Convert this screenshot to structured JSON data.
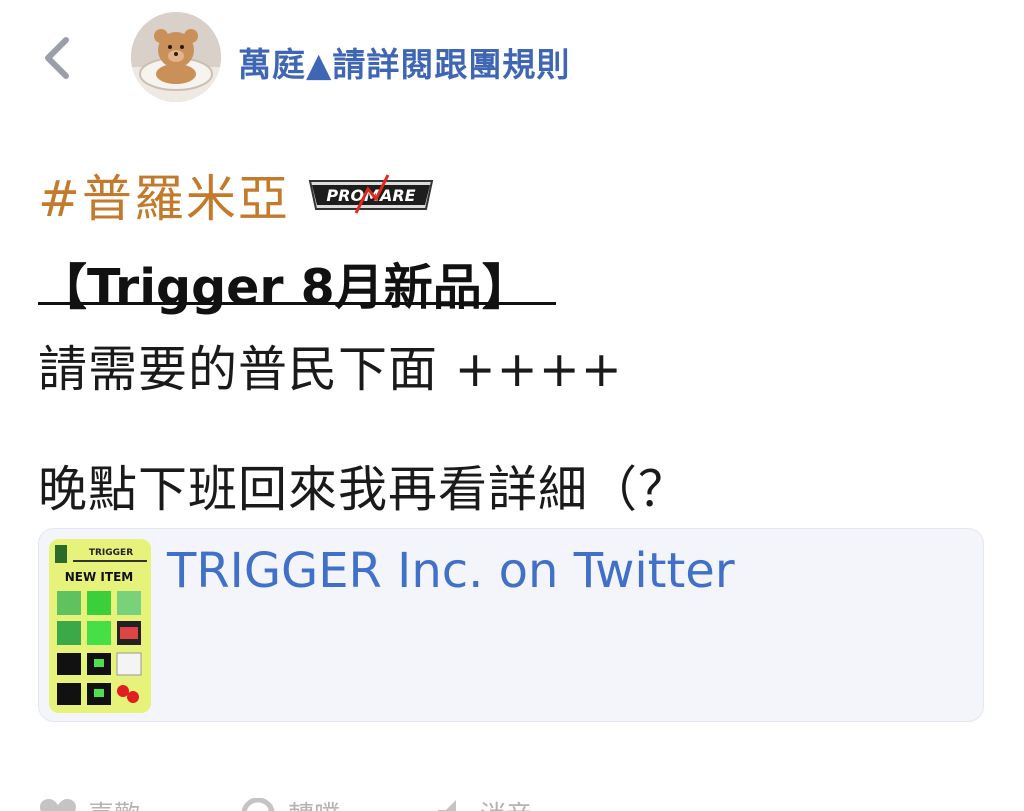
{
  "header": {
    "back_icon": "chevron-left-icon",
    "author_name": "萬庭▲請詳閱跟團規則"
  },
  "post": {
    "hashtag": "#普羅米亞",
    "logo_text": "PROMARE",
    "title": "【Trigger 8月新品】",
    "line1": "請需要的普民下面 ++++",
    "line2": "晚點下班回來我再看詳細（？"
  },
  "link_card": {
    "title": "TRIGGER Inc. on Twitter",
    "thumb": {
      "brand": "TRIGGER",
      "label": "NEW ITEM"
    }
  },
  "actions": [
    {
      "label": "喜歡",
      "icon": "heart-icon"
    },
    {
      "label": "轉噗",
      "icon": "repost-icon"
    },
    {
      "label": "消音",
      "icon": "mute-icon"
    }
  ],
  "colors": {
    "author": "#3f66b5",
    "hashtag": "#c47a2c",
    "link": "#4070c8",
    "card_bg": "#f3f5fa"
  }
}
